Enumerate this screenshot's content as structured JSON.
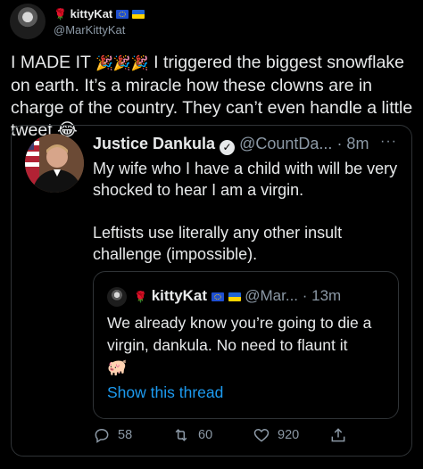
{
  "author": {
    "name": "kittyKat",
    "handle": "@MarKittyKat"
  },
  "tweet": {
    "text_part1": "I MADE IT",
    "text_part2": " I triggered the biggest snowflake on earth. It’s a miracle how these clowns are in charge of the country. They can’t even handle a little tweet"
  },
  "quoted": {
    "name": "Justice Dankula",
    "handle": "@CountDa...",
    "time": "· 8m",
    "text": "My wife who I have a child with will be very shocked to hear I am a virgin.\n\nLeftists use literally any other insult challenge (impossible).",
    "menu": "···"
  },
  "nested_quote": {
    "name": "kittyKat",
    "handle": "@Mar...",
    "time": "· 13m",
    "text": "We already know you’re going to die a virgin, dankula. No need to flaunt it",
    "show_thread": "Show this thread"
  },
  "actions": {
    "replies": "58",
    "retweets": "60",
    "likes": "920"
  },
  "colors": {
    "background": "#000000",
    "text": "#e7e9ea",
    "muted": "#8b98a5",
    "link": "#1d9bf0",
    "border": "#2f3336"
  }
}
